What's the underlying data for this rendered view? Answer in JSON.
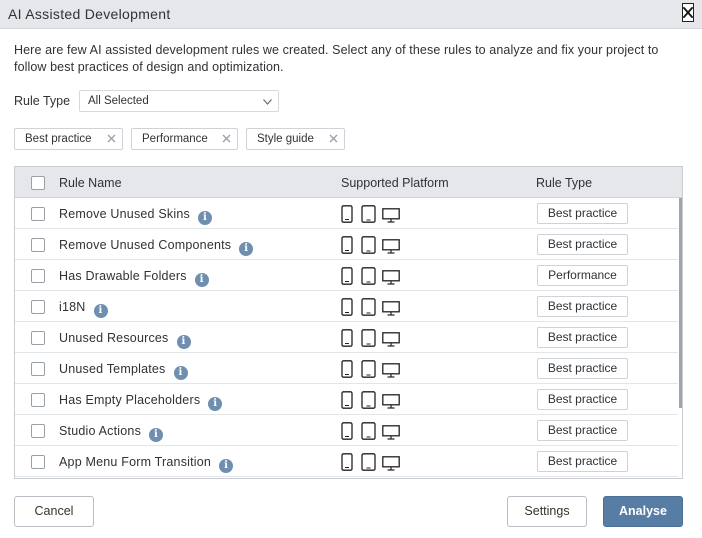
{
  "dialog": {
    "title": "AI Assisted Development",
    "close_icon": "close-icon"
  },
  "intro_text": "Here are few AI assisted development rules we created. Select any of these rules to analyze and fix your project to follow best practices of design and optimization.",
  "filter": {
    "label": "Rule Type",
    "selected": "All Selected"
  },
  "chips": [
    {
      "label": "Best practice"
    },
    {
      "label": "Performance"
    },
    {
      "label": "Style guide"
    }
  ],
  "table": {
    "headers": {
      "name": "Rule Name",
      "platform": "Supported Platform",
      "type": "Rule Type"
    },
    "rows": [
      {
        "name": "Remove Unused Skins",
        "type": "Best practice"
      },
      {
        "name": "Remove Unused Components",
        "type": "Best practice"
      },
      {
        "name": "Has Drawable Folders",
        "type": "Performance"
      },
      {
        "name": "i18N",
        "type": "Best practice"
      },
      {
        "name": "Unused Resources",
        "type": "Best practice"
      },
      {
        "name": "Unused Templates",
        "type": "Best practice"
      },
      {
        "name": "Has Empty Placeholders",
        "type": "Best practice"
      },
      {
        "name": "Studio Actions",
        "type": "Best practice"
      },
      {
        "name": "App Menu Form Transition",
        "type": "Best practice"
      }
    ],
    "platform_icons": [
      "mobile-phone-icon",
      "tablet-icon",
      "desktop-icon"
    ],
    "info_icon": "info-icon"
  },
  "footer": {
    "cancel_label": "Cancel",
    "settings_label": "Settings",
    "analyse_label": "Analyse"
  },
  "colors": {
    "primary_button": "#587da4",
    "info_icon": "#6f8fb0",
    "header_bg": "#e5e7ea"
  }
}
